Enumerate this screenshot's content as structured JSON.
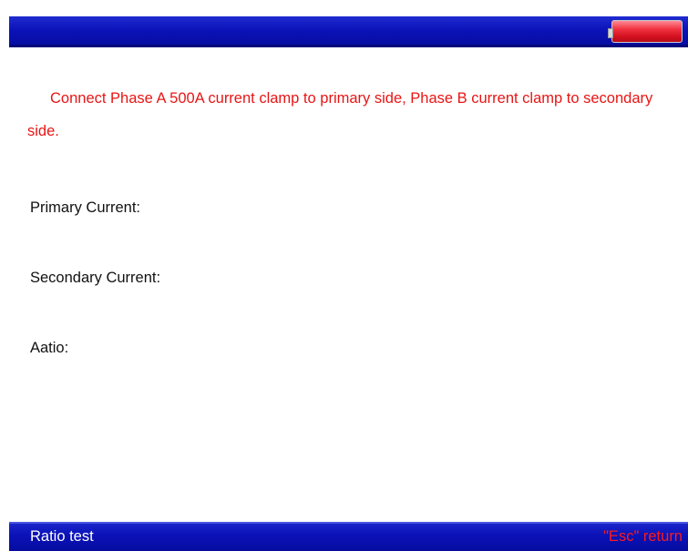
{
  "header": {
    "battery_icon": "battery-icon",
    "battery_color": "#e0202f",
    "bar_color": "#0b12b8"
  },
  "main": {
    "instruction": "Connect Phase A 500A current clamp to primary side, Phase B current clamp to secondary side.",
    "instruction_color": "#e81515",
    "primary_current_label": "Primary Current:",
    "secondary_current_label": "Secondary Current:",
    "ratio_label": "Aatio:"
  },
  "footer": {
    "title": "Ratio test",
    "esc_hint": "\"Esc\" return",
    "esc_color": "#ff1a1a"
  }
}
